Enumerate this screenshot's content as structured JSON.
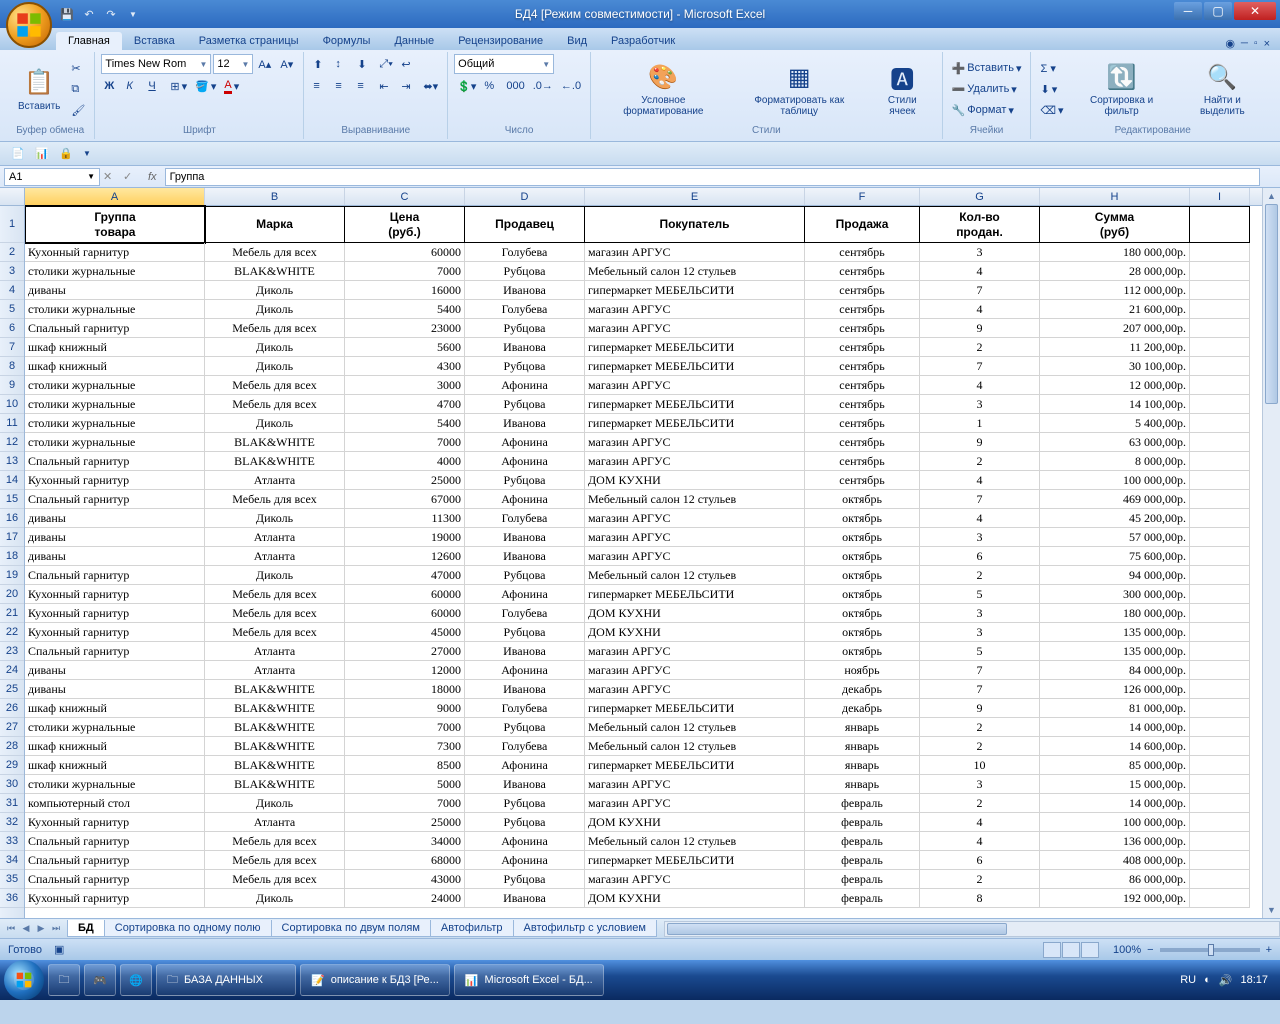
{
  "window": {
    "title": "БД4  [Режим совместимости] - Microsoft Excel"
  },
  "ribbon": {
    "tabs": [
      "Главная",
      "Вставка",
      "Разметка страницы",
      "Формулы",
      "Данные",
      "Рецензирование",
      "Вид",
      "Разработчик"
    ],
    "active_tab": 0,
    "groups": {
      "clipboard": {
        "label": "Буфер обмена",
        "paste": "Вставить"
      },
      "font": {
        "label": "Шрифт",
        "name": "Times New Rom",
        "size": "12",
        "bold": "Ж",
        "italic": "К",
        "underline": "Ч"
      },
      "align": {
        "label": "Выравнивание"
      },
      "number": {
        "label": "Число",
        "format": "Общий"
      },
      "styles": {
        "label": "Стили",
        "cond": "Условное форматирование",
        "table": "Форматировать как таблицу",
        "cell": "Стили ячеек"
      },
      "cells": {
        "label": "Ячейки",
        "insert": "Вставить",
        "delete": "Удалить",
        "format": "Формат"
      },
      "editing": {
        "label": "Редактирование",
        "sort": "Сортировка и фильтр",
        "find": "Найти и выделить"
      }
    }
  },
  "namebox": "A1",
  "formula": "Группа",
  "columns": [
    "A",
    "B",
    "C",
    "D",
    "E",
    "F",
    "G",
    "H",
    "I"
  ],
  "headers": {
    "A": "Группа\nтовара",
    "B": "Марка",
    "C": "Цена\n(руб.)",
    "D": "Продавец",
    "E": "Покупатель",
    "F": "Продажа",
    "G": "Кол-во\nпродан.",
    "H": "Сумма\n(руб)"
  },
  "rows": [
    {
      "n": 2,
      "A": "Кухонный гарнитур",
      "B": "Мебель для всех",
      "C": "60000",
      "D": "Голубева",
      "E": "магазин АРГУС",
      "F": "сентябрь",
      "G": "3",
      "H": "180 000,00р."
    },
    {
      "n": 3,
      "A": "столики журнальные",
      "B": "BLAK&WHITE",
      "C": "7000",
      "D": "Рубцова",
      "E": "Мебельный салон 12 стульев",
      "F": "сентябрь",
      "G": "4",
      "H": "28 000,00р."
    },
    {
      "n": 4,
      "A": "диваны",
      "B": "Диколь",
      "C": "16000",
      "D": "Иванова",
      "E": "гипермаркет МЕБЕЛЬСИТИ",
      "F": "сентябрь",
      "G": "7",
      "H": "112 000,00р."
    },
    {
      "n": 5,
      "A": "столики журнальные",
      "B": "Диколь",
      "C": "5400",
      "D": "Голубева",
      "E": "магазин АРГУС",
      "F": "сентябрь",
      "G": "4",
      "H": "21 600,00р."
    },
    {
      "n": 6,
      "A": "Спальный гарнитур",
      "B": "Мебель для всех",
      "C": "23000",
      "D": "Рубцова",
      "E": "магазин АРГУС",
      "F": "сентябрь",
      "G": "9",
      "H": "207 000,00р."
    },
    {
      "n": 7,
      "A": "шкаф книжный",
      "B": "Диколь",
      "C": "5600",
      "D": "Иванова",
      "E": "гипермаркет МЕБЕЛЬСИТИ",
      "F": "сентябрь",
      "G": "2",
      "H": "11 200,00р."
    },
    {
      "n": 8,
      "A": "шкаф книжный",
      "B": "Диколь",
      "C": "4300",
      "D": "Рубцова",
      "E": "гипермаркет МЕБЕЛЬСИТИ",
      "F": "сентябрь",
      "G": "7",
      "H": "30 100,00р."
    },
    {
      "n": 9,
      "A": "столики журнальные",
      "B": "Мебель для всех",
      "C": "3000",
      "D": "Афонина",
      "E": "магазин АРГУС",
      "F": "сентябрь",
      "G": "4",
      "H": "12 000,00р."
    },
    {
      "n": 10,
      "A": "столики журнальные",
      "B": "Мебель для всех",
      "C": "4700",
      "D": "Рубцова",
      "E": "гипермаркет МЕБЕЛЬСИТИ",
      "F": "сентябрь",
      "G": "3",
      "H": "14 100,00р."
    },
    {
      "n": 11,
      "A": "столики журнальные",
      "B": "Диколь",
      "C": "5400",
      "D": "Иванова",
      "E": "гипермаркет МЕБЕЛЬСИТИ",
      "F": "сентябрь",
      "G": "1",
      "H": "5 400,00р."
    },
    {
      "n": 12,
      "A": "столики журнальные",
      "B": "BLAK&WHITE",
      "C": "7000",
      "D": "Афонина",
      "E": "магазин АРГУС",
      "F": "сентябрь",
      "G": "9",
      "H": "63 000,00р."
    },
    {
      "n": 13,
      "A": "Спальный гарнитур",
      "B": "BLAK&WHITE",
      "C": "4000",
      "D": "Афонина",
      "E": "магазин АРГУС",
      "F": "сентябрь",
      "G": "2",
      "H": "8 000,00р."
    },
    {
      "n": 14,
      "A": "Кухонный гарнитур",
      "B": "Атланта",
      "C": "25000",
      "D": "Рубцова",
      "E": "ДОМ КУХНИ",
      "F": "сентябрь",
      "G": "4",
      "H": "100 000,00р."
    },
    {
      "n": 15,
      "A": "Спальный гарнитур",
      "B": "Мебель для всех",
      "C": "67000",
      "D": "Афонина",
      "E": "Мебельный салон 12 стульев",
      "F": "октябрь",
      "G": "7",
      "H": "469 000,00р."
    },
    {
      "n": 16,
      "A": "диваны",
      "B": "Диколь",
      "C": "11300",
      "D": "Голубева",
      "E": "магазин АРГУС",
      "F": "октябрь",
      "G": "4",
      "H": "45 200,00р."
    },
    {
      "n": 17,
      "A": "диваны",
      "B": "Атланта",
      "C": "19000",
      "D": "Иванова",
      "E": "магазин АРГУС",
      "F": "октябрь",
      "G": "3",
      "H": "57 000,00р."
    },
    {
      "n": 18,
      "A": "диваны",
      "B": "Атланта",
      "C": "12600",
      "D": "Иванова",
      "E": "магазин АРГУС",
      "F": "октябрь",
      "G": "6",
      "H": "75 600,00р."
    },
    {
      "n": 19,
      "A": "Спальный гарнитур",
      "B": "Диколь",
      "C": "47000",
      "D": "Рубцова",
      "E": "Мебельный салон 12 стульев",
      "F": "октябрь",
      "G": "2",
      "H": "94 000,00р."
    },
    {
      "n": 20,
      "A": "Кухонный гарнитур",
      "B": "Мебель для всех",
      "C": "60000",
      "D": "Афонина",
      "E": "гипермаркет МЕБЕЛЬСИТИ",
      "F": "октябрь",
      "G": "5",
      "H": "300 000,00р."
    },
    {
      "n": 21,
      "A": "Кухонный гарнитур",
      "B": "Мебель для всех",
      "C": "60000",
      "D": "Голубева",
      "E": "ДОМ КУХНИ",
      "F": "октябрь",
      "G": "3",
      "H": "180 000,00р."
    },
    {
      "n": 22,
      "A": "Кухонный гарнитур",
      "B": "Мебель для всех",
      "C": "45000",
      "D": "Рубцова",
      "E": "ДОМ КУХНИ",
      "F": "октябрь",
      "G": "3",
      "H": "135 000,00р."
    },
    {
      "n": 23,
      "A": "Спальный гарнитур",
      "B": "Атланта",
      "C": "27000",
      "D": "Иванова",
      "E": "магазин АРГУС",
      "F": "октябрь",
      "G": "5",
      "H": "135 000,00р."
    },
    {
      "n": 24,
      "A": "диваны",
      "B": "Атланта",
      "C": "12000",
      "D": "Афонина",
      "E": "магазин АРГУС",
      "F": "ноябрь",
      "G": "7",
      "H": "84 000,00р."
    },
    {
      "n": 25,
      "A": "диваны",
      "B": "BLAK&WHITE",
      "C": "18000",
      "D": "Иванова",
      "E": "магазин АРГУС",
      "F": "декабрь",
      "G": "7",
      "H": "126 000,00р."
    },
    {
      "n": 26,
      "A": "шкаф книжный",
      "B": "BLAK&WHITE",
      "C": "9000",
      "D": "Голубева",
      "E": "гипермаркет МЕБЕЛЬСИТИ",
      "F": "декабрь",
      "G": "9",
      "H": "81 000,00р."
    },
    {
      "n": 27,
      "A": "столики журнальные",
      "B": "BLAK&WHITE",
      "C": "7000",
      "D": "Рубцова",
      "E": "Мебельный салон 12 стульев",
      "F": "январь",
      "G": "2",
      "H": "14 000,00р."
    },
    {
      "n": 28,
      "A": "шкаф книжный",
      "B": "BLAK&WHITE",
      "C": "7300",
      "D": "Голубева",
      "E": "Мебельный салон 12 стульев",
      "F": "январь",
      "G": "2",
      "H": "14 600,00р."
    },
    {
      "n": 29,
      "A": "шкаф книжный",
      "B": "BLAK&WHITE",
      "C": "8500",
      "D": "Афонина",
      "E": "гипермаркет МЕБЕЛЬСИТИ",
      "F": "январь",
      "G": "10",
      "H": "85 000,00р."
    },
    {
      "n": 30,
      "A": "столики журнальные",
      "B": "BLAK&WHITE",
      "C": "5000",
      "D": "Иванова",
      "E": "магазин АРГУС",
      "F": "январь",
      "G": "3",
      "H": "15 000,00р."
    },
    {
      "n": 31,
      "A": "компьютерный стол",
      "B": "Диколь",
      "C": "7000",
      "D": "Рубцова",
      "E": "магазин АРГУС",
      "F": "февраль",
      "G": "2",
      "H": "14 000,00р."
    },
    {
      "n": 32,
      "A": "Кухонный гарнитур",
      "B": "Атланта",
      "C": "25000",
      "D": "Рубцова",
      "E": "ДОМ КУХНИ",
      "F": "февраль",
      "G": "4",
      "H": "100 000,00р."
    },
    {
      "n": 33,
      "A": "Спальный гарнитур",
      "B": "Мебель для всех",
      "C": "34000",
      "D": "Афонина",
      "E": "Мебельный салон 12 стульев",
      "F": "февраль",
      "G": "4",
      "H": "136 000,00р."
    },
    {
      "n": 34,
      "A": "Спальный гарнитур",
      "B": "Мебель для всех",
      "C": "68000",
      "D": "Афонина",
      "E": "гипермаркет МЕБЕЛЬСИТИ",
      "F": "февраль",
      "G": "6",
      "H": "408 000,00р."
    },
    {
      "n": 35,
      "A": "Спальный гарнитур",
      "B": "Мебель для всех",
      "C": "43000",
      "D": "Рубцова",
      "E": "магазин АРГУС",
      "F": "февраль",
      "G": "2",
      "H": "86 000,00р."
    },
    {
      "n": 36,
      "A": "Кухонный гарнитур",
      "B": "Диколь",
      "C": "24000",
      "D": "Иванова",
      "E": "ДОМ КУХНИ",
      "F": "февраль",
      "G": "8",
      "H": "192 000,00р."
    }
  ],
  "sheets": {
    "tabs": [
      "БД",
      "Сортировка по одному полю",
      "Сортировка по двум полям",
      "Автофильтр",
      "Автофильтр с условием"
    ],
    "active": 0
  },
  "status": {
    "ready": "Готово",
    "zoom": "100%"
  },
  "taskbar": {
    "items": [
      "БАЗА ДАННЫХ",
      "описание к БД3 [Ре...",
      "Microsoft Excel - БД..."
    ],
    "lang": "RU",
    "time": "18:17"
  }
}
